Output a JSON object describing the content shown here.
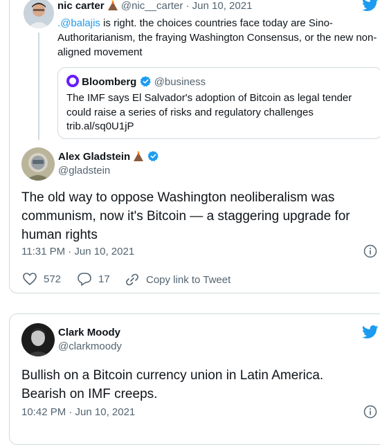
{
  "reply_tweet": {
    "author_name": "nic carter",
    "handle": "@nic__carter",
    "separator": "·",
    "date": "Jun 10, 2021",
    "mention": ".@balajis",
    "text_line1": " is right. the choices countries face today are Sino-",
    "text_line2": "Authoritarianism, the fraying Washington Consensus, or the new non-",
    "text_line3": "aligned movement"
  },
  "quoted_tweet": {
    "author_name": "Bloomberg",
    "handle": "@business",
    "text_line1": "The IMF says El Salvador's adoption of Bitcoin as legal tender",
    "text_line2": "could raise a series of risks and regulatory challenges",
    "text_line3": "trib.al/sq0U1jP"
  },
  "main_tweet": {
    "author_name": "Alex Gladstein",
    "handle": "@gladstein",
    "text_line1": "The old way to oppose Washington neoliberalism was",
    "text_line2": "communism, now it's Bitcoin — a staggering upgrade for",
    "text_line3": "human rights",
    "timestamp": "11:31 PM · Jun 10, 2021",
    "likes": "572",
    "replies": "17",
    "copy_link_label": "Copy link to Tweet"
  },
  "second_tweet": {
    "author_name": "Clark Moody",
    "handle": "@clarkmoody",
    "text_line1": "Bullish on a Bitcoin currency union in Latin America.",
    "text_line2": "Bearish on IMF creeps.",
    "timestamp": "10:42 PM · Jun 10, 2021"
  },
  "colors": {
    "twitter_blue": "#1d9bf0",
    "bloomberg_purple": "#6a1bff",
    "text_muted": "#536471",
    "border": "#cfd9de"
  },
  "icons": [
    "twitter-bird-icon",
    "verified-badge-icon",
    "volcano-emoji-icon",
    "info-icon",
    "heart-icon",
    "reply-icon",
    "link-icon"
  ]
}
